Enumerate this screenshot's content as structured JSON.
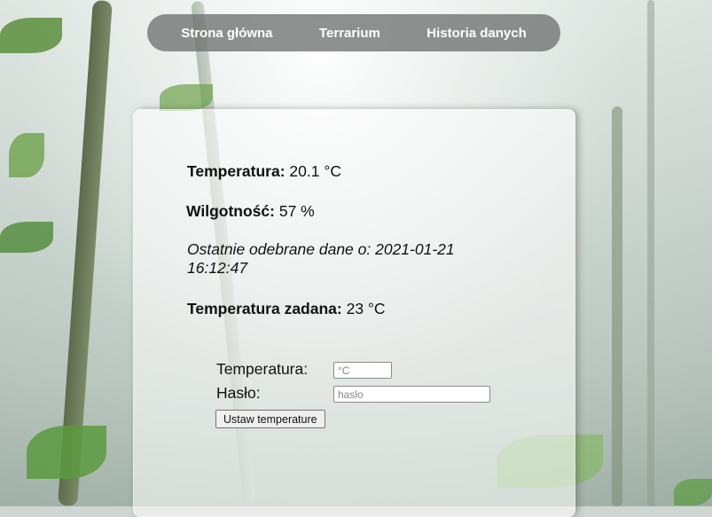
{
  "nav": {
    "items": [
      {
        "label": "Strona główna"
      },
      {
        "label": "Terrarium"
      },
      {
        "label": "Historia danych"
      }
    ]
  },
  "readings": {
    "temperature_label": "Temperatura:",
    "temperature_value": "20.1 °C",
    "humidity_label": "Wilgotność:",
    "humidity_value": "57 %",
    "last_received": "Ostatnie odebrane dane o: 2021-01-21 16:12:47",
    "set_temperature_label": "Temperatura zadana:",
    "set_temperature_value": "23 °C"
  },
  "form": {
    "temperature_label": "Temperatura:",
    "temperature_placeholder": "°C",
    "password_label": "Hasło:",
    "password_placeholder": "haslo",
    "submit_label": "Ustaw temperature"
  },
  "colors": {
    "nav_background": "#6e7271",
    "nav_text": "#ffffff",
    "panel_background": "#ffffff"
  }
}
